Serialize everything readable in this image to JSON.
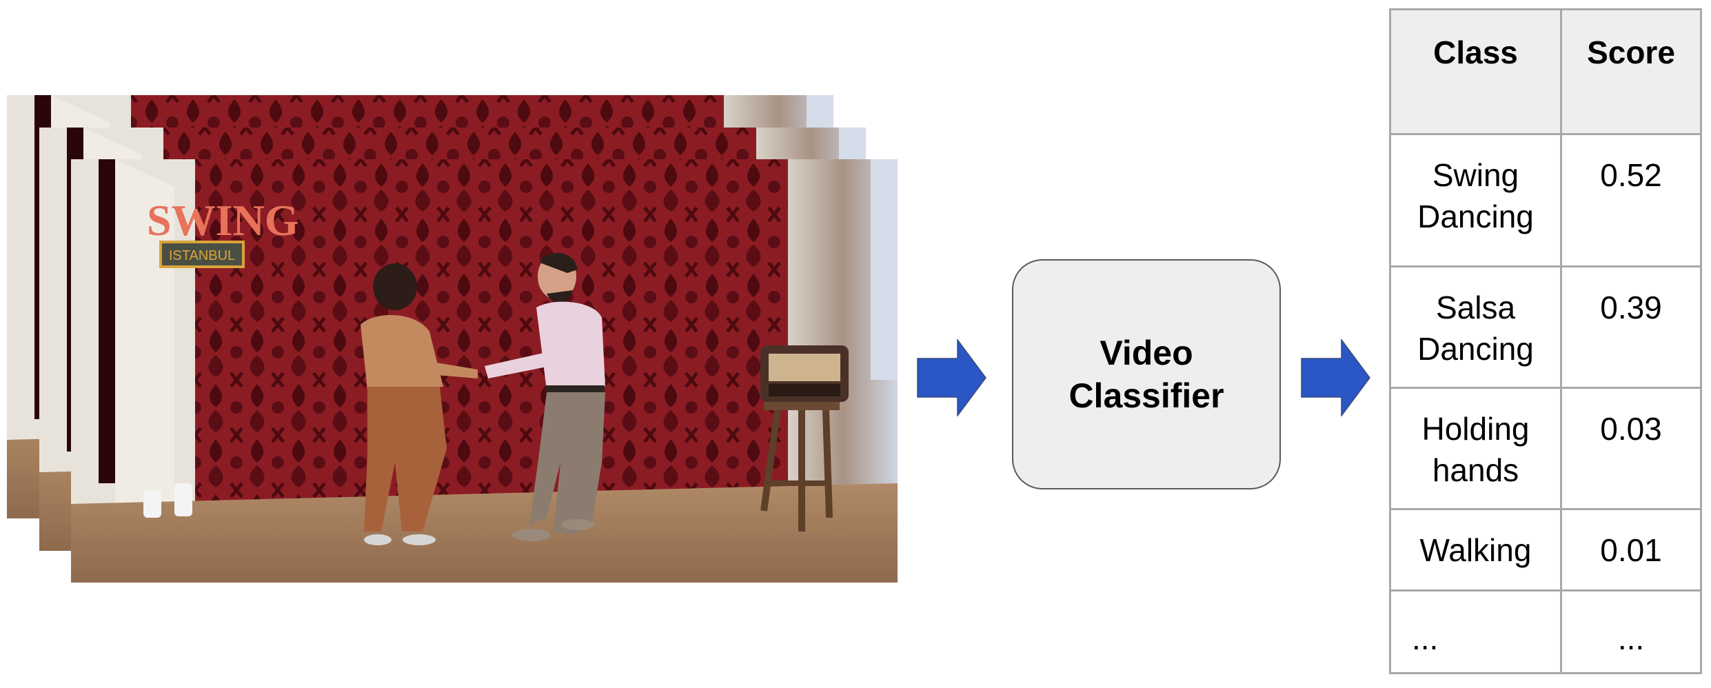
{
  "input": {
    "description": "Stack of video frames showing a couple dancing in front of a red damask curtain",
    "frame_count_shown": 3,
    "logo_text": {
      "title": "SWING",
      "subtitle": "ISTANBUL"
    }
  },
  "model": {
    "label_line1": "Video",
    "label_line2": "Classifier"
  },
  "colors": {
    "arrow": "#2a56c6",
    "box_fill": "#eeeeee",
    "box_border": "#595959",
    "table_header": "#eeeeee",
    "table_border": "#a8a8a8",
    "curtain": "#8a1c22"
  },
  "output_table": {
    "headers": [
      "Class",
      "Score"
    ],
    "rows": [
      {
        "class_line1": "Swing",
        "class_line2": "Dancing",
        "score": "0.52"
      },
      {
        "class_line1": "Salsa",
        "class_line2": "Dancing",
        "score": "0.39"
      },
      {
        "class_line1": "Holding",
        "class_line2": "hands",
        "score": "0.03"
      },
      {
        "class_line1": "Walking",
        "class_line2": "",
        "score": "0.01"
      },
      {
        "class_line1": "...",
        "class_line2": "",
        "score": "..."
      }
    ]
  }
}
